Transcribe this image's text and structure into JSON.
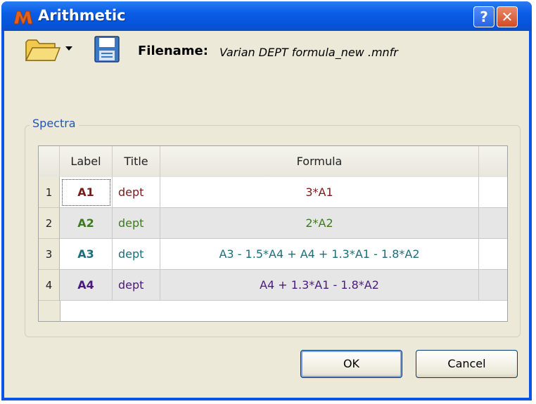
{
  "window": {
    "title": "Arithmetic",
    "help_glyph": "?",
    "close_glyph": "✕"
  },
  "toolbar": {
    "filename_label": "Filename:",
    "filename_value": "Varian DEPT formula_new .mnfr"
  },
  "spectra": {
    "group_label": "Spectra",
    "columns": [
      "Label",
      "Title",
      "Formula"
    ],
    "rows": [
      {
        "num": "1",
        "label": "A1",
        "title": "dept",
        "formula": "3*A1",
        "color": "#7a1a1a"
      },
      {
        "num": "2",
        "label": "A2",
        "title": "dept",
        "formula": "2*A2",
        "color": "#3d7a1f"
      },
      {
        "num": "3",
        "label": "A3",
        "title": "dept",
        "formula": "A3 - 1.5*A4 + A4 + 1.3*A1 - 1.8*A2",
        "color": "#1a6f7a"
      },
      {
        "num": "4",
        "label": "A4",
        "title": "dept",
        "formula": "A4 + 1.3*A1 - 1.8*A2",
        "color": "#4a1a7a"
      }
    ]
  },
  "buttons": {
    "ok": "OK",
    "cancel": "Cancel"
  },
  "icons": {
    "app": "mnova-icon",
    "open": "folder-icon",
    "dropdown": "chevron-down-icon",
    "save": "floppy-disk-icon"
  }
}
